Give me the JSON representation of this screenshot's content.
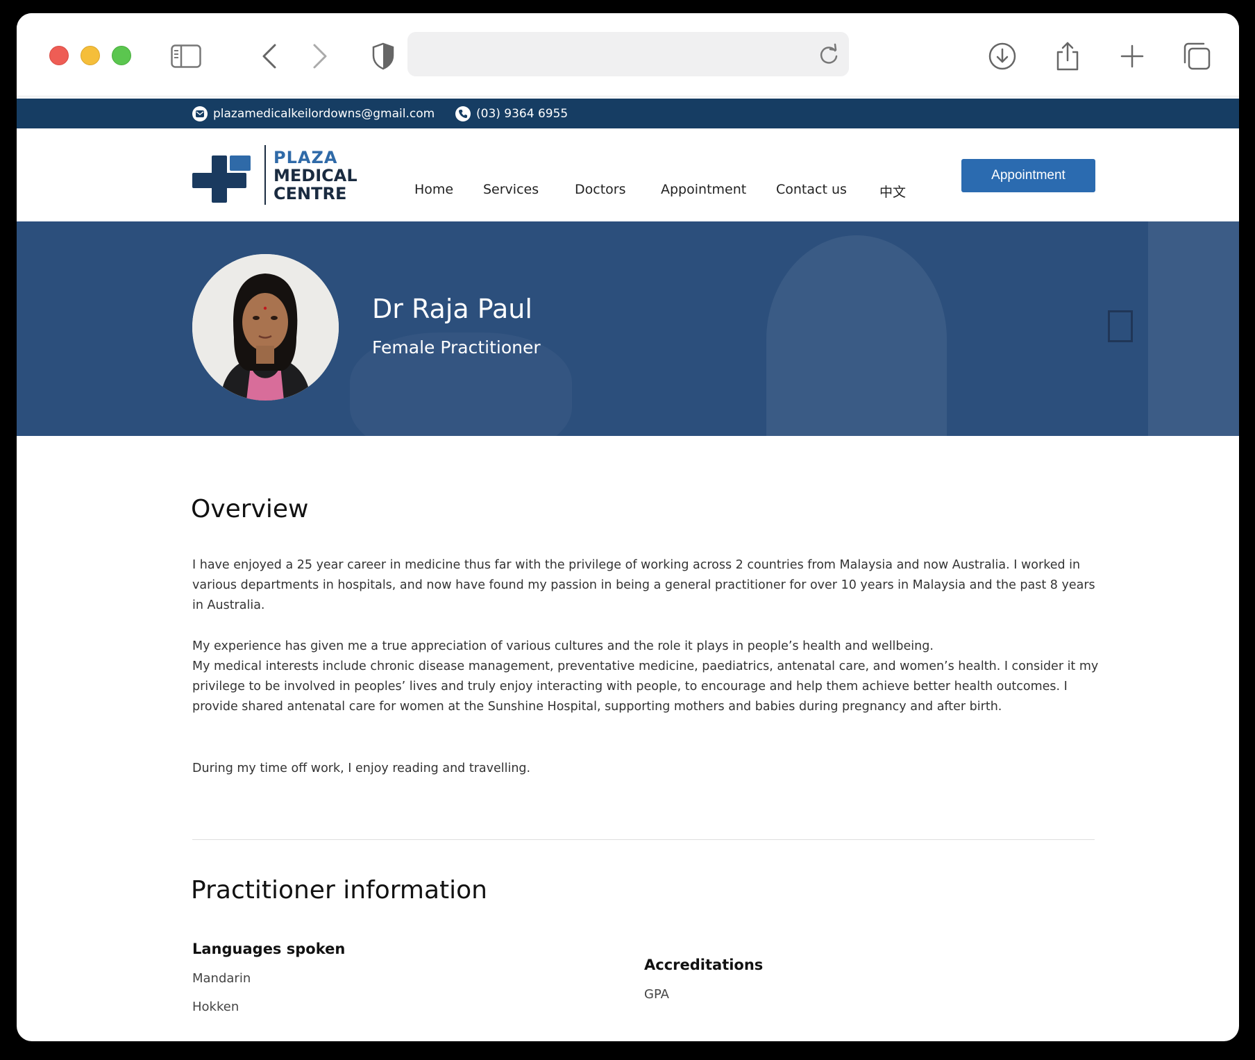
{
  "browser": {
    "url_value": "",
    "url_placeholder": ""
  },
  "topbar": {
    "email": "plazamedicalkeilordowns@gmail.com",
    "phone": "(03) 9364 6955"
  },
  "logo": {
    "line1": "PLAZA",
    "line2": "MEDICAL",
    "line3": "CENTRE",
    "colors": {
      "accent": "#2f6aa8",
      "dark": "#1a2b40"
    }
  },
  "nav": {
    "items": [
      "Home",
      "Services",
      "Doctors",
      "Appointment",
      "Contact us",
      "中文"
    ],
    "cta": "Appointment"
  },
  "hero": {
    "name": "Dr Raja Paul",
    "subtitle": "Female Practitioner"
  },
  "overview": {
    "heading": "Overview",
    "paragraphs": [
      "I have enjoyed a 25 year career in medicine thus far with the privilege of working across 2 countries from Malaysia and now Australia. I worked in various departments in hospitals, and now have found my passion in being a general practitioner for over 10 years in Malaysia and the past 8 years in Australia.",
      "My experience has given me a true appreciation of various cultures and the role it plays in people’s health and wellbeing.",
      "My medical interests include chronic disease management, preventative medicine, paediatrics, antenatal care, and women’s health. I consider it my privilege to be involved in peoples’ lives and truly enjoy interacting with people, to encourage and help them achieve better health outcomes. I provide shared antenatal care for women at the Sunshine Hospital, supporting mothers and babies during pregnancy and after birth.",
      "During my time off work, I enjoy reading and travelling."
    ]
  },
  "practitioner": {
    "heading": "Practitioner information",
    "languages_heading": "Languages spoken",
    "languages": [
      "Mandarin",
      "Hokken"
    ],
    "accreditations_heading": "Accreditations",
    "accreditations": [
      "GPA"
    ]
  },
  "colors": {
    "topbar": "#163d63",
    "hero": "#2c4f7c",
    "button": "#2b6bb0"
  },
  "icons": [
    "sidebar-icon",
    "back-icon",
    "forward-icon",
    "shield-icon",
    "reload-icon",
    "download-icon",
    "share-icon",
    "new-tab-icon",
    "tabs-icon",
    "email-icon",
    "phone-icon"
  ]
}
